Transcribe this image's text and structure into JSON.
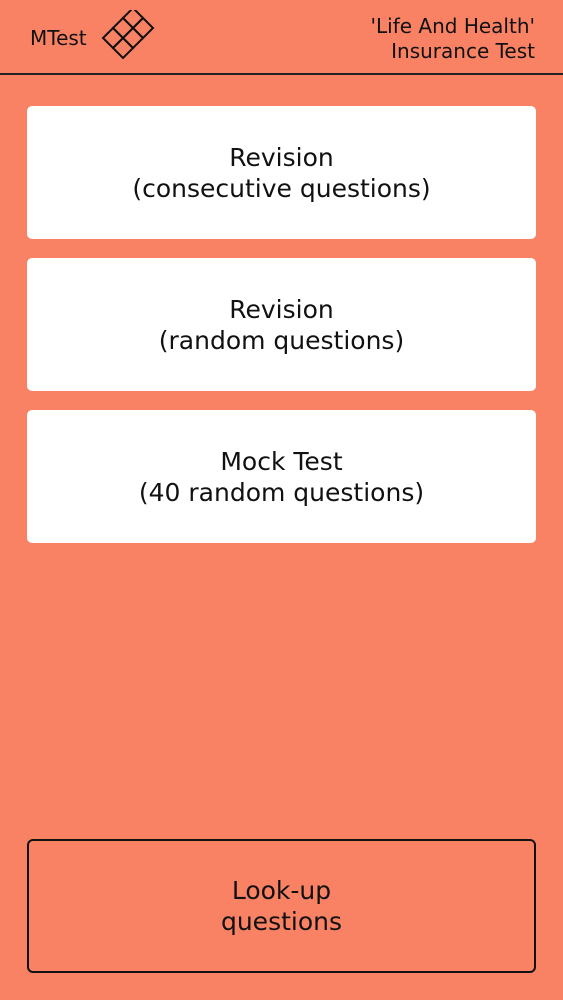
{
  "header": {
    "app_name": "MTest",
    "logo_icon": "diamond-grid-icon",
    "title_line1": "'Life And Health'",
    "title_line2": "Insurance Test"
  },
  "menu": [
    {
      "line1": "Revision",
      "line2": "(consecutive questions)"
    },
    {
      "line1": "Revision",
      "line2": "(random questions)"
    },
    {
      "line1": "Mock Test",
      "line2": "(40 random questions)"
    }
  ],
  "lookup": {
    "line1": "Look-up",
    "line2": "questions"
  },
  "colors": {
    "background": "#fa8264",
    "button": "#ffffff",
    "text": "#111111"
  }
}
